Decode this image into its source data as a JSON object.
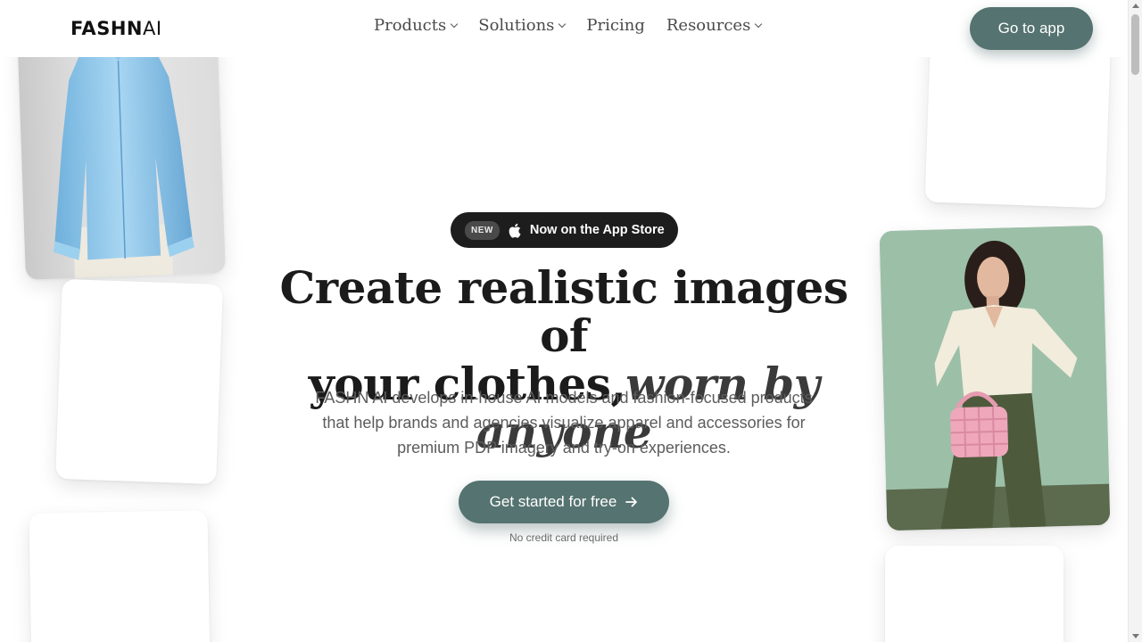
{
  "header": {
    "logo_bold": "FASHN",
    "logo_light": "AI",
    "nav": [
      {
        "label": "Products",
        "has_dropdown": true
      },
      {
        "label": "Solutions",
        "has_dropdown": true
      },
      {
        "label": "Pricing",
        "has_dropdown": false
      },
      {
        "label": "Resources",
        "has_dropdown": true
      }
    ],
    "cta_label": "Go to app"
  },
  "hero": {
    "badge_new": "NEW",
    "badge_icon": "apple-icon",
    "badge_text": "Now on the App Store",
    "headline_line1": "Create realistic images of",
    "headline_line2_plain": "your clothes,",
    "headline_line2_italic": "worn by anyone",
    "subtitle": "FASHN AI develops in-house AI models and fashion-focused products that help brands and agencies visualize apparel and accessories for premium PDP imagery and try-on experiences.",
    "cta_label": "Get started for free",
    "cta_icon": "arrow-right-icon",
    "note": "No credit card required"
  },
  "colors": {
    "accent": "#557370",
    "badge_bg": "#1d1d1d",
    "shirt": "#8fc4e8",
    "model_bg": "#9cbfa8"
  }
}
